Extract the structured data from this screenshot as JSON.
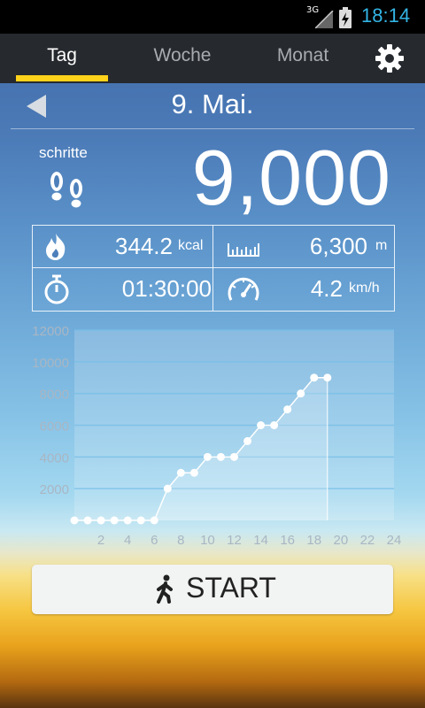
{
  "status_bar": {
    "network": "3G",
    "time": "18:14"
  },
  "tabs": [
    {
      "label": "Tag",
      "active": true
    },
    {
      "label": "Woche",
      "active": false
    },
    {
      "label": "Monat",
      "active": false
    }
  ],
  "settings_icon": "gear-icon",
  "date": {
    "label": "9. Mai."
  },
  "steps": {
    "label": "schritte",
    "value": "9,000"
  },
  "stats": {
    "calories": {
      "value": "344.2",
      "unit": "kcal",
      "icon": "flame-icon"
    },
    "distance": {
      "value": "6,300",
      "unit": "m",
      "icon": "ruler-icon"
    },
    "duration": {
      "value": "01:30:00",
      "icon": "stopwatch-icon"
    },
    "speed": {
      "value": "4.2",
      "unit": "km/h",
      "icon": "speedometer-icon"
    }
  },
  "chart_data": {
    "type": "area",
    "title": "",
    "xlabel": "",
    "ylabel": "",
    "x": [
      0,
      1,
      2,
      3,
      4,
      5,
      6,
      7,
      8,
      9,
      10,
      11,
      12,
      13,
      14,
      15,
      16,
      17,
      18,
      19
    ],
    "y": [
      0,
      0,
      0,
      0,
      0,
      0,
      0,
      2000,
      3000,
      3000,
      4000,
      4000,
      4000,
      5000,
      6000,
      6000,
      7000,
      8000,
      9000,
      9000
    ],
    "xlim": [
      0,
      24
    ],
    "ylim": [
      0,
      12000
    ],
    "x_ticks": [
      "2",
      "4",
      "6",
      "8",
      "10",
      "12",
      "14",
      "16",
      "18",
      "20",
      "22",
      "24"
    ],
    "y_ticks": [
      "2000",
      "4000",
      "6000",
      "8000",
      "10000",
      "12000"
    ],
    "grid": true,
    "colors": {
      "line": "#ffffff",
      "fill": "rgba(255,255,255,0.22)",
      "tick_label": "#a9b6c3"
    }
  },
  "start_button": {
    "label": "START",
    "icon": "walking-person-icon"
  },
  "colors": {
    "accent": "#ffd21a",
    "clock": "#33b5e5",
    "tabbar": "#26292e"
  }
}
